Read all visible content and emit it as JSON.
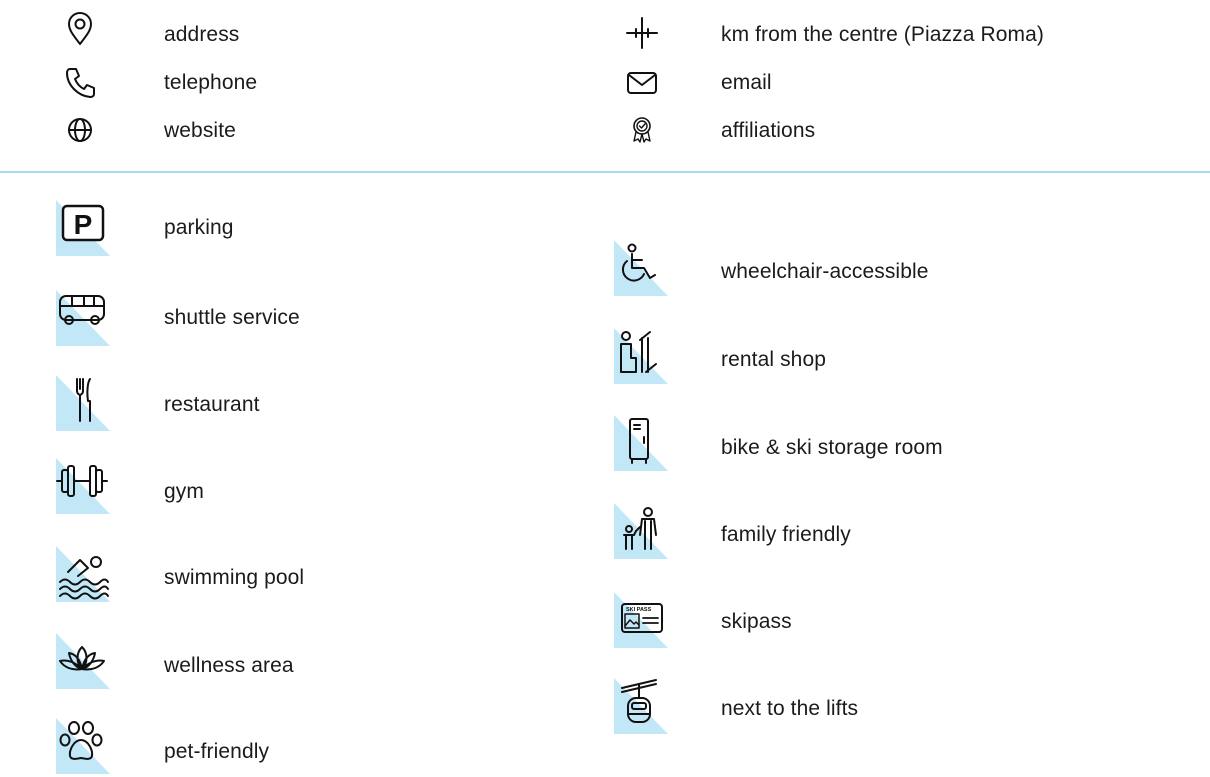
{
  "legend_top": {
    "left": [
      {
        "icon": "location-pin-icon",
        "label": "address"
      },
      {
        "icon": "phone-icon",
        "label": "telephone"
      },
      {
        "icon": "globe-icon",
        "label": "website"
      }
    ],
    "right": [
      {
        "icon": "crosshair-icon",
        "label": "km from the centre (Piazza Roma)"
      },
      {
        "icon": "envelope-icon",
        "label": "email"
      },
      {
        "icon": "award-badge-icon",
        "label": "affiliations"
      }
    ]
  },
  "amenities": {
    "left": [
      {
        "icon": "parking-icon",
        "label": "parking",
        "glyph": "P"
      },
      {
        "icon": "shuttle-bus-icon",
        "label": "shuttle service"
      },
      {
        "icon": "fork-knife-icon",
        "label": "restaurant"
      },
      {
        "icon": "dumbbell-icon",
        "label": "gym"
      },
      {
        "icon": "swimmer-icon",
        "label": "swimming pool"
      },
      {
        "icon": "lotus-icon",
        "label": "wellness area"
      },
      {
        "icon": "paw-icon",
        "label": "pet-friendly"
      }
    ],
    "right": [
      {
        "icon": "wheelchair-icon",
        "label": "wheelchair-accessible"
      },
      {
        "icon": "ski-rental-icon",
        "label": "rental shop"
      },
      {
        "icon": "locker-icon",
        "label": "bike & ski storage room"
      },
      {
        "icon": "family-icon",
        "label": "family friendly"
      },
      {
        "icon": "skipass-card-icon",
        "label": "skipass",
        "card_text": "SKI PASS"
      },
      {
        "icon": "cable-car-icon",
        "label": "next to the lifts"
      }
    ]
  },
  "colors": {
    "accent_triangle": "#c2e8f8",
    "divider": "#a9dcef",
    "text": "#1b1b1b"
  }
}
